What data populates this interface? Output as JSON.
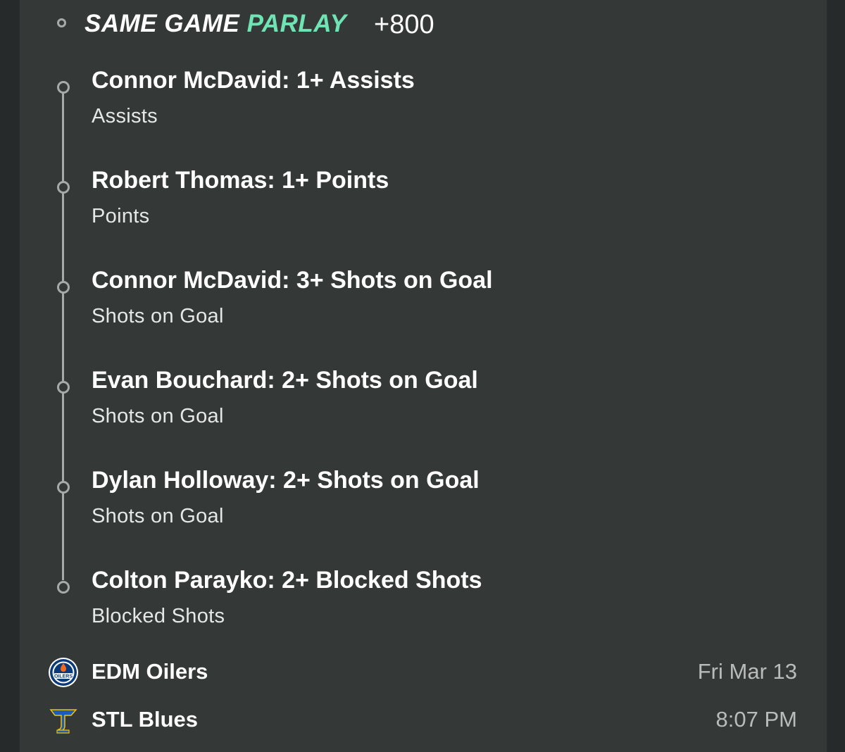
{
  "header": {
    "title_part1": "SAME GAME",
    "title_part2": "PARLAY",
    "odds": "+800",
    "accent_color": "#6fe3b4"
  },
  "legs": [
    {
      "title": "Connor McDavid: 1+ Assists",
      "market": "Assists"
    },
    {
      "title": "Robert Thomas: 1+ Points",
      "market": "Points"
    },
    {
      "title": "Connor McDavid: 3+ Shots on Goal",
      "market": "Shots on Goal"
    },
    {
      "title": "Evan Bouchard: 2+ Shots on Goal",
      "market": "Shots on Goal"
    },
    {
      "title": "Dylan Holloway: 2+ Shots on Goal",
      "market": "Shots on Goal"
    },
    {
      "title": "Colton Parayko: 2+ Blocked Shots",
      "market": "Blocked Shots"
    }
  ],
  "game": {
    "teams": [
      {
        "name": "EDM Oilers",
        "logo": "oilers-logo-icon",
        "logo_text": "OILERS",
        "meta": "Fri Mar 13"
      },
      {
        "name": "STL Blues",
        "logo": "blues-logo-icon",
        "meta": "8:07 PM"
      }
    ]
  }
}
